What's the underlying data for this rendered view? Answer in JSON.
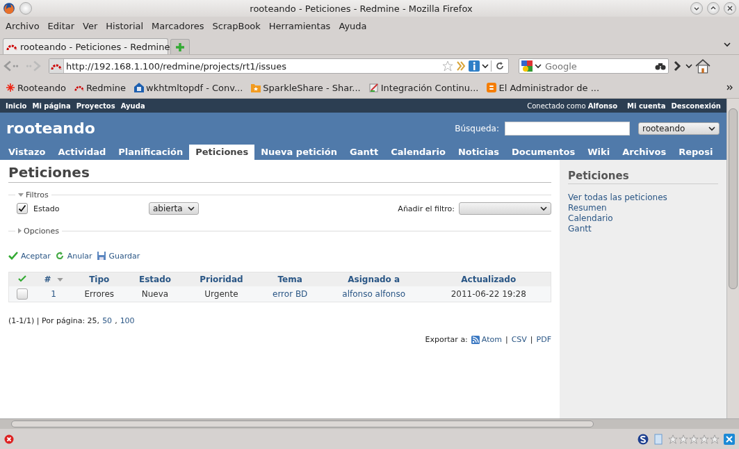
{
  "window": {
    "title": "rooteando - Peticiones - Redmine - Mozilla Firefox"
  },
  "menu": [
    "Archivo",
    "Editar",
    "Ver",
    "Historial",
    "Marcadores",
    "ScrapBook",
    "Herramientas",
    "Ayuda"
  ],
  "browser_tabs": [
    {
      "label": "rooteando - Peticiones - Redmine",
      "selected": true
    }
  ],
  "address_bar": {
    "value": "http://192.168.1.100/redmine/projects/rt1/issues"
  },
  "web_search": {
    "placeholder": "Google"
  },
  "bookmarks": [
    {
      "label": "Rooteando",
      "kind": "star"
    },
    {
      "label": "Redmine",
      "kind": "redmine"
    },
    {
      "label": "wkhtmltopdf - Conv...",
      "kind": "house"
    },
    {
      "label": "SparkleShare - Shar...",
      "kind": "folder"
    },
    {
      "label": "Integración Continu...",
      "kind": "notepad"
    },
    {
      "label": "El Administrador de ...",
      "kind": "blogger"
    }
  ],
  "top_menu": {
    "links": [
      "Inicio",
      "Mi página",
      "Proyectos",
      "Ayuda"
    ],
    "logged_in_as": "Conectado como",
    "user": "Alfonso",
    "account_links": [
      "Mi cuenta",
      "Desconexión"
    ]
  },
  "header": {
    "project": "rooteando",
    "search_label": "Búsqueda:",
    "project_select": "rooteando"
  },
  "main_tabs": [
    {
      "label": "Vistazo",
      "selected": false
    },
    {
      "label": "Actividad",
      "selected": false
    },
    {
      "label": "Planificación",
      "selected": false
    },
    {
      "label": "Peticiones",
      "selected": true
    },
    {
      "label": "Nueva petición",
      "selected": false
    },
    {
      "label": "Gantt",
      "selected": false
    },
    {
      "label": "Calendario",
      "selected": false
    },
    {
      "label": "Noticias",
      "selected": false
    },
    {
      "label": "Documentos",
      "selected": false
    },
    {
      "label": "Wiki",
      "selected": false
    },
    {
      "label": "Archivos",
      "selected": false
    },
    {
      "label": "Reposi",
      "selected": false
    }
  ],
  "page_title": "Peticiones",
  "filters": {
    "legend": "Filtros",
    "expanded": true,
    "rows": [
      {
        "label": "Estado",
        "checked": true,
        "operator": "abierta"
      }
    ],
    "add_filter_label": "Añadir el filtro:"
  },
  "options": {
    "legend": "Opciones",
    "expanded": false
  },
  "actions": [
    {
      "label": "Aceptar",
      "kind": "apply"
    },
    {
      "label": "Anular",
      "kind": "reset"
    },
    {
      "label": "Guardar",
      "kind": "save"
    }
  ],
  "table": {
    "columns": [
      "#",
      "Tipo",
      "Estado",
      "Prioridad",
      "Tema",
      "Asignado a",
      "Actualizado"
    ],
    "rows": [
      {
        "checked": false,
        "cells": [
          "1",
          "Errores",
          "Nueva",
          "Urgente",
          "error BD",
          "alfonso alfonso",
          "2011-06-22 19:28"
        ]
      }
    ]
  },
  "pagination": {
    "summary": "(1-1/1) | Por página: 25,",
    "links": [
      "50",
      "100"
    ],
    "separator": ","
  },
  "export": {
    "label": "Exportar a:",
    "links": [
      "Atom",
      "CSV",
      "PDF"
    ],
    "separator": "|"
  },
  "sidebar": {
    "title": "Peticiones",
    "links": [
      "Ver todas las peticiones",
      "Resumen",
      "Calendario",
      "Gantt"
    ]
  },
  "status_bar": {
    "stars": 0
  }
}
